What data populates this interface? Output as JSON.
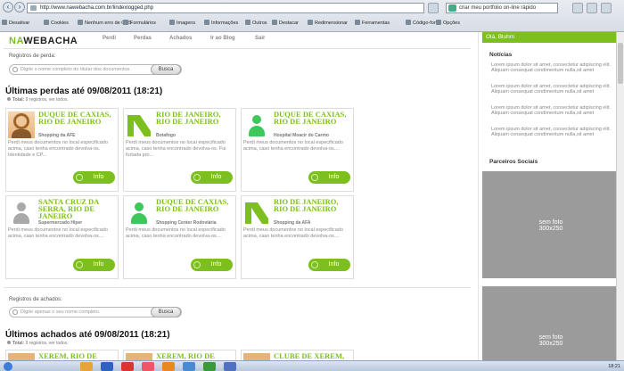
{
  "browser": {
    "url": "http://www.nawebacha.com.br/lindexlogged.php",
    "search_text": "criar meu portfolio on-line rápido",
    "toolbar_items": [
      "Desativar",
      "Cookies",
      "Nenhum erro de CSS",
      "Formulários",
      "Imagens",
      "Informações",
      "Outros",
      "Destacar",
      "Redimensionar",
      "Ferramentas",
      "Código-fonte",
      "Opções"
    ]
  },
  "site": {
    "logo_prefix": "NA",
    "logo_suffix": "WEBACHA",
    "menu": [
      "Perdi",
      "Perdas",
      "Achados",
      "Ir ao Blog",
      "Sair"
    ]
  },
  "lost": {
    "search_label": "Registros de perda:",
    "search_placeholder": "Digite o nome completo do titular dos documentos.",
    "search_button": "Busca",
    "title": "Últimas perdas até 09/08/2011 (18:21)",
    "total_prefix": "Total:",
    "total_text": "9 registros,",
    "total_link": "ver todos.",
    "info_label": "Info",
    "cards": [
      {
        "city": "DUQUE DE CAXIAS, RIO DE JANEIRO",
        "place": "Shopping da AFE",
        "desc": "Perdi meus documentos no local especificado acima, caso tenha encontrado devolva-os. Identidade e CP...",
        "thumb": "photo"
      },
      {
        "city": "RIO DE JANEIRO, RIO DE JANEIRO",
        "place": "Botafogo",
        "desc": "Perdi meus documentos no local especificado acima, caso tenha encontrado devolva-os. Fui furtada pro...",
        "thumb": "logo"
      },
      {
        "city": "DUQUE DE CAXIAS, RIO DE JANEIRO",
        "place": "Hospital Moacir do Carmo",
        "desc": "Perdi meus documentos no local especificado acima, caso tenha encontrado devolva-os....",
        "thumb": "green"
      },
      {
        "city": "SANTA CRUZ DA SERRA, RIO DE JANEIRO",
        "place": "Supermercado Hiper",
        "desc": "Perdi meus documentos no local especificado acima, caso tenha encontrado devolva-os....",
        "thumb": "gray"
      },
      {
        "city": "DUQUE DE CAXIAS, RIO DE JANEIRO",
        "place": "Shopping Center Rodoviária",
        "desc": "Perdi meus documentos no local especificado acima, caso tenha encontrado devolva-os....",
        "thumb": "green"
      },
      {
        "city": "RIO DE JANEIRO, RIO DE JANEIRO",
        "place": "Shopping da AFA",
        "desc": "Perdi meus documentos no local especificado acima, caso tenha encontrado devolva-os....",
        "thumb": "logo"
      }
    ]
  },
  "found": {
    "search_label": "Registros de achados:",
    "search_placeholder": "Digite apenas o seu nome completo.",
    "search_button": "Busca",
    "title": "Últimos achados até 09/08/2011 (18:21)",
    "total_prefix": "Total:",
    "total_text": "9 registros,",
    "total_link": "ver todos.",
    "cards": [
      {
        "city": "XEREM, RIO DE"
      },
      {
        "city": "XEREM, RIO DE"
      },
      {
        "city": "CLUBE DE XEREM,"
      }
    ]
  },
  "sidebar": {
    "greeting": "Olá, Bluhm",
    "news_title": "Notícias",
    "news": [
      "Lorem ipsum dolor sit amet, consectetur adipiscing elit. Aliquam consequat condimentum nulla,sit amet",
      "Lorem ipsum dolor sit amet, consectetur adipiscing elit. Aliquam consequat condimentum nulla,sit amet",
      "Lorem ipsum dolor sit amet, consectetur adipiscing elit. Aliquam consequat condimentum nulla,sit amet",
      "Lorem ipsum dolor sit amet, consectetur adipiscing elit. Aliquam consequat condimentum nulla,sit amet"
    ],
    "partners_title": "Parceiros Sociais",
    "ads": [
      {
        "line1": "sem foto",
        "line2": "300x250"
      },
      {
        "line1": "sem foto",
        "line2": "300x250"
      }
    ]
  },
  "taskbar": {
    "clock": "18:21"
  },
  "colors": {
    "accent": "#7cbf1e",
    "ad_gray": "#9b9b9b"
  }
}
